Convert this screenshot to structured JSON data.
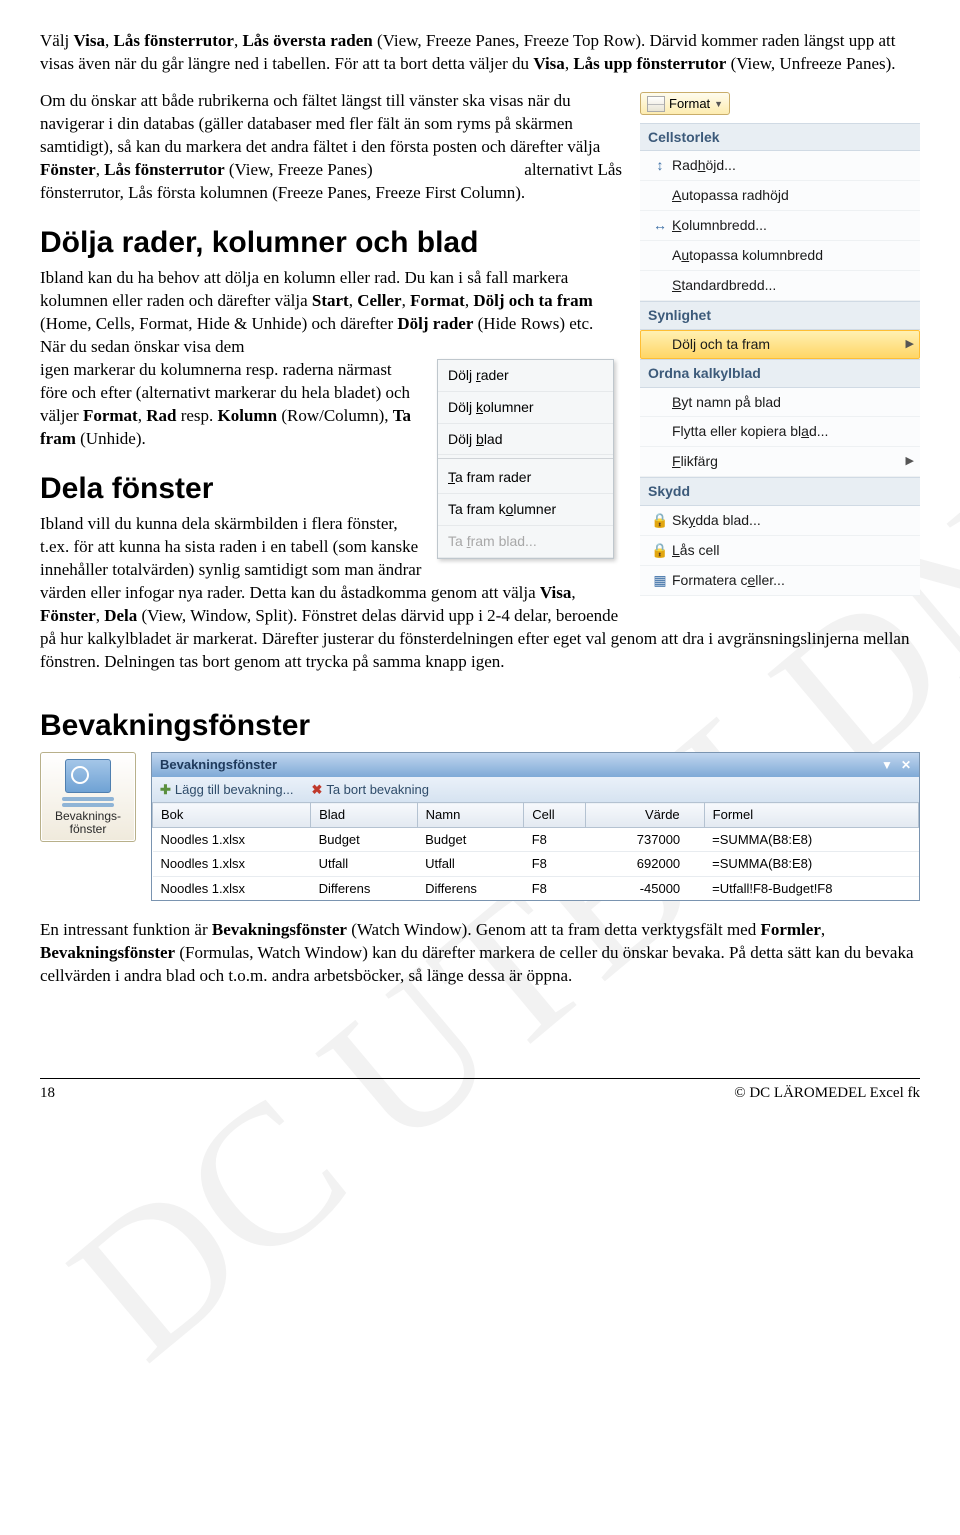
{
  "para1_a": "Välj ",
  "para1_b1": "Visa",
  "para1_b2": "Lås fönsterrutor",
  "para1_b3": "Lås översta raden",
  "para1_c": " (View, Freeze Panes, Freeze Top Row). Därvid kommer raden längst upp att visas även när du går längre ned i tabellen. För att ta bort detta väljer du ",
  "para1_d1": "Visa",
  "para1_d2": "Lås upp fönsterrutor",
  "para1_e": " (View, Unfreeze Panes).",
  "para2_a": "Om du önskar att både rubrikerna och fältet längst till vänster ska visas när du navigerar i din databas (gäller databaser med fler fält än som ryms på skärmen samtidigt), så kan du markera det andra fältet i den första posten och därefter välja ",
  "para2_b1": "Fönster",
  "para2_b2": "Lås fönsterrutor",
  "para2_c": " (View, Freeze Panes)",
  "para2_d": "alternativt Lås",
  "para2_e": "fönsterrutor, Lås första kolumnen (Freeze Panes, Freeze First Column).",
  "h_dolja": "Dölja rader, kolumner och blad",
  "para3_a": "Ibland kan du ha behov att dölja en kolumn eller rad. Du kan i så fall markera kolumnen eller raden och därefter välja ",
  "para3_b1": "Start",
  "para3_b2": "Celler",
  "para3_b3": "Format",
  "para3_b4": "Dölj och ta fram",
  "para3_c": " (Home, Cells, Format, Hide & Unhide) och därefter ",
  "para3_d": "Dölj rader",
  "para3_e": " (Hide Rows) etc. När du sedan önskar visa dem",
  "para3_f": "igen markerar du kolumnerna resp. raderna närmast före och efter (alternativt markerar du hela bladet) och väljer ",
  "para3_g1": "Format",
  "para3_g2": "Rad",
  "para3_h": " resp. ",
  "para3_i": "Kolumn",
  "para3_j": " (Row/Column), ",
  "para3_k": "Ta fram",
  "para3_l": " (Unhide).",
  "h_dela": "Dela fönster",
  "para4_a": "Ibland vill du kunna dela skärmbilden i flera fönster, t.ex. för att kunna ha sista raden i en tabell (som kanske innehåller totalvärden) synlig samtidigt som man ändrar värden eller infogar nya rader. Detta kan du åstadkomma genom att välja ",
  "para4_b1": "Visa",
  "para4_b2": "Fönster",
  "para4_b3": "Dela",
  "para4_c": " (View, Window, Split). Fönstret delas därvid upp i 2-4 delar, beroende på hur kalkylbladet är markerat. Därefter justerar du fönsterdelningen efter eget val genom att dra i avgränsningslinjerna mellan fönstren. Delningen tas bort genom att trycka på samma knapp igen.",
  "h_bev": "Bevakningsfönster",
  "para5_a": "En intressant funktion är ",
  "para5_b": "Bevakningsfönster",
  "para5_c": " (Watch Window). Genom att ta fram detta verktygsfält med ",
  "para5_d1": "Formler",
  "para5_d2": "Bevakningsfönster",
  "para5_e": " (Formulas, Watch Window) kan du därefter markera de celler du önskar bevaka. På detta sätt kan du bevaka cellvärden i andra blad och t.o.m. andra arbetsböcker, så länge dessa är öppna.",
  "format_btn": "Format",
  "grp_cell": "Cellstorlek",
  "mi_radhojd": "Radhöjd...",
  "mi_autoh": "Autopassa radhöjd",
  "mi_kolbredd": "Kolumnbredd...",
  "mi_autokol": "Autopassa kolumnbredd",
  "mi_stdbredd": "Standardbredd...",
  "grp_syn": "Synlighet",
  "mi_dolj": "Dölj och ta fram",
  "grp_ordna": "Ordna kalkylblad",
  "mi_byt": "Byt namn på blad",
  "mi_flytta": "Flytta eller kopiera blad...",
  "mi_flik": "Flikfärg",
  "grp_skydd": "Skydd",
  "mi_skydda": "Skydda blad...",
  "mi_las": "Lås cell",
  "mi_formc": "Formatera celler...",
  "sm_dr": "Dölj rader",
  "sm_dk": "Dölj kolumner",
  "sm_db": "Dölj blad",
  "sm_tr": "Ta fram rader",
  "sm_tk": "Ta fram kolumner",
  "sm_tb": "Ta fram blad...",
  "watch_btn": "Bevaknings-\nfönster",
  "watch_title": "Bevakningsfönster",
  "watch_add": "Lägg till bevakning...",
  "watch_del": "Ta bort bevakning",
  "wt_h": {
    "bok": "Bok",
    "blad": "Blad",
    "namn": "Namn",
    "cell": "Cell",
    "varde": "Värde",
    "formel": "Formel"
  },
  "wt_rows": [
    {
      "bok": "Noodles 1.xlsx",
      "blad": "Budget",
      "namn": "Budget",
      "cell": "F8",
      "varde": "737000",
      "formel": "=SUMMA(B8:E8)"
    },
    {
      "bok": "Noodles 1.xlsx",
      "blad": "Utfall",
      "namn": "Utfall",
      "cell": "F8",
      "varde": "692000",
      "formel": "=SUMMA(B8:E8)"
    },
    {
      "bok": "Noodles 1.xlsx",
      "blad": "Differens",
      "namn": "Differens",
      "cell": "F8",
      "varde": "-45000",
      "formel": "=Utfall!F8-Budget!F8"
    }
  ],
  "footer_page": "18",
  "footer_right": "©  DC  LÄROMEDEL  Excel fk"
}
